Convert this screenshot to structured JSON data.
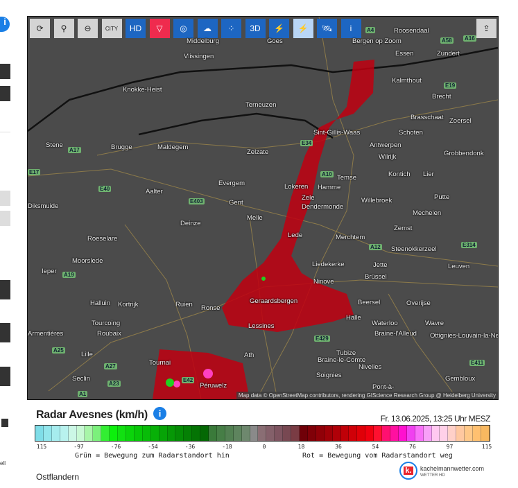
{
  "toolbar": {
    "buttons": [
      {
        "name": "refresh",
        "icon": "refresh-icon",
        "label": "⟳",
        "style": "g"
      },
      {
        "name": "location",
        "icon": "map-pin-icon",
        "label": "⚲",
        "style": "g"
      },
      {
        "name": "zoom-out",
        "icon": "zoom-out-icon",
        "label": "⊖",
        "style": "g"
      },
      {
        "name": "city",
        "icon": "city-labels-icon",
        "label": "CITY",
        "style": "g"
      },
      {
        "name": "radar-hd",
        "icon": "radar-hd-icon",
        "label": "HD",
        "style": "b"
      },
      {
        "name": "tornado",
        "icon": "tornado-icon",
        "label": "▽",
        "style": "r"
      },
      {
        "name": "rotation",
        "icon": "rotation-icon",
        "label": "◎",
        "style": "b"
      },
      {
        "name": "hail-cloud",
        "icon": "hail-cloud-icon",
        "label": "☁",
        "style": "b"
      },
      {
        "name": "hail",
        "icon": "hail-icon",
        "label": "⁘",
        "style": "b"
      },
      {
        "name": "radar-3d",
        "icon": "radar-3d-icon",
        "label": "3D",
        "style": "b"
      },
      {
        "name": "lightning",
        "icon": "lightning-icon",
        "label": "⚡",
        "style": "b"
      },
      {
        "name": "doppler",
        "icon": "doppler-icon",
        "label": "⚡",
        "style": "a"
      },
      {
        "name": "satellite",
        "icon": "satellite-icon",
        "label": "🛰",
        "style": "b"
      },
      {
        "name": "radar-info",
        "icon": "radar-info-icon",
        "label": "i",
        "style": "b"
      }
    ],
    "share_icon": "share-icon"
  },
  "map": {
    "attribution": "Map data © OpenStreetMap contributors, rendering GIScience Research Group @ Heidelberg University",
    "cities": [
      "Middelburg",
      "Goes",
      "Vlissingen",
      "Bergen op Zoom",
      "Roosendaal",
      "Zundert",
      "Essen",
      "Kalmthout",
      "Knokke-Heist",
      "Terneuzen",
      "Brecht",
      "Brasschaat",
      "Zoersel",
      "Sint-Gillis-Waas",
      "Schoten",
      "Stene",
      "Brugge",
      "Maldegem",
      "Zelzate",
      "Antwerpen",
      "Grobbendonk",
      "Wilrijk",
      "Kontich",
      "Lier",
      "Temse",
      "Hamme",
      "Lokeren",
      "Evergem",
      "Aalter",
      "Diksmuide",
      "Gent",
      "Zele",
      "Dendermonde",
      "Willebroek",
      "Putte",
      "Melle",
      "Mechelen",
      "Deinze",
      "Lede",
      "Zemst",
      "Merchtem",
      "Roeselare",
      "Steenokkerzeel",
      "Moorslede",
      "Liedekerke",
      "Jette",
      "Leuven",
      "Ieper",
      "Ninove",
      "Brüssel",
      "Kortrijk",
      "Geraardsbergen",
      "Beersel",
      "Overijse",
      "Halluin",
      "Ruien",
      "Ronse",
      "Halle",
      "Waterloo",
      "Wavre",
      "Tourcoing",
      "Lessines",
      "Roubaix",
      "Braine-l'Alleud",
      "Ottignies-Louvain-la-Neuve",
      "Tubize",
      "Armentières",
      "Lille",
      "Ath",
      "Braine-le-Comte",
      "Nivelles",
      "Tournai",
      "Soignies",
      "Seclin",
      "Gembloux",
      "Péruwelz",
      "Pont-à-"
    ],
    "highways": [
      "A4",
      "A58",
      "A16",
      "E19",
      "E34",
      "A10",
      "E17",
      "E40",
      "E403",
      "A12",
      "E314",
      "A19",
      "A17",
      "E429",
      "A25",
      "A27",
      "E42",
      "A23",
      "E411",
      "A1"
    ]
  },
  "legend": {
    "title": "Radar Avesnes (km/h)",
    "timestamp": "Fr. 13.06.2025, 13:25 Uhr MESZ",
    "ticks": [
      "115",
      "-97",
      "-76",
      "-54",
      "-36",
      "-18",
      "0",
      "18",
      "36",
      "54",
      "76",
      "97",
      "115"
    ],
    "green_note": "Grün = Bewegung zum Radarstandort hin",
    "red_note": "Rot = Bewegung vom Radarstandort weg",
    "region": "Ostflandern",
    "brand": "kachelmannwetter.com",
    "brand_sub": "WETTER HD",
    "logo_letter": "k.",
    "colors": [
      "#7fdde8",
      "#93e6ec",
      "#a6ecee",
      "#b8f2ee",
      "#ccf7e6",
      "#c8f8d4",
      "#a8f5a8",
      "#7cf07c",
      "#33ee33",
      "#0cf00c",
      "#11e011",
      "#0bd40b",
      "#08c808",
      "#08bc08",
      "#07b007",
      "#06a406",
      "#069806",
      "#058c05",
      "#058005",
      "#047404",
      "#046804",
      "#3a7a3a",
      "#467e46",
      "#528052",
      "#5e845e",
      "#6e886e",
      "#8a8a8a",
      "#8a6e74",
      "#84606a",
      "#7e5460",
      "#784852",
      "#7a3c44",
      "#700008",
      "#800008",
      "#900008",
      "#a00008",
      "#b00008",
      "#c00008",
      "#d00008",
      "#e00008",
      "#f00010",
      "#ff1030",
      "#ff1070",
      "#ff10a0",
      "#ff10d0",
      "#f040f0",
      "#f870f8",
      "#f8a0f8",
      "#ffc8f0",
      "#ffd0e8",
      "#ffd0c8",
      "#ffc8a0",
      "#ffc888",
      "#ffc070",
      "#f8b860"
    ]
  },
  "sidebar": {
    "partial_text": "ell"
  }
}
